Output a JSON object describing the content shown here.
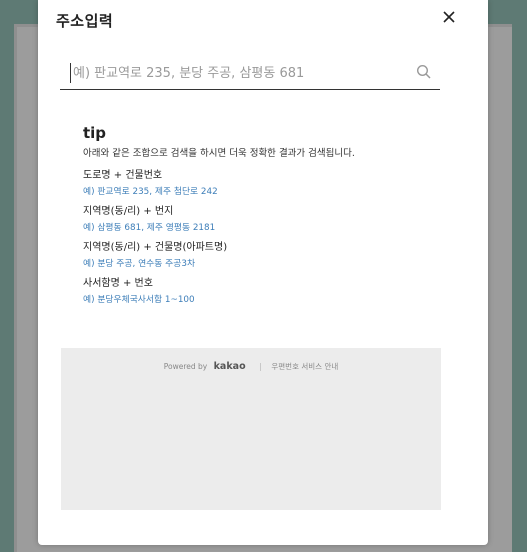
{
  "modal": {
    "title": "주소입력"
  },
  "search": {
    "placeholder": "예) 판교역로 235, 분당 주공, 삼평동 681"
  },
  "tip": {
    "title": "tip",
    "description": "아래와 같은 조합으로 검색을 하시면 더욱 정확한 결과가 검색됩니다.",
    "items": [
      {
        "label": "도로명 + 건물번호",
        "example": "예) 판교역로 235,  제주 첨단로 242"
      },
      {
        "label": "지역명(동/리) + 번지",
        "example": "예) 삼평동 681,  제주 영평동 2181"
      },
      {
        "label": "지역명(동/리) + 건물명(아파트명)",
        "example": "예) 분당 주공,  연수동 주공3차"
      },
      {
        "label": "사서함명 + 번호",
        "example": "예) 분당우체국사서함 1~100"
      }
    ]
  },
  "footer": {
    "powered_by": "Powered by",
    "brand": "kakao",
    "link": "우편번호 서비스 안내"
  },
  "colors": {
    "example_text": "#3f7fb9",
    "backdrop": "#5e7a74",
    "footer_bg": "#ececec"
  }
}
